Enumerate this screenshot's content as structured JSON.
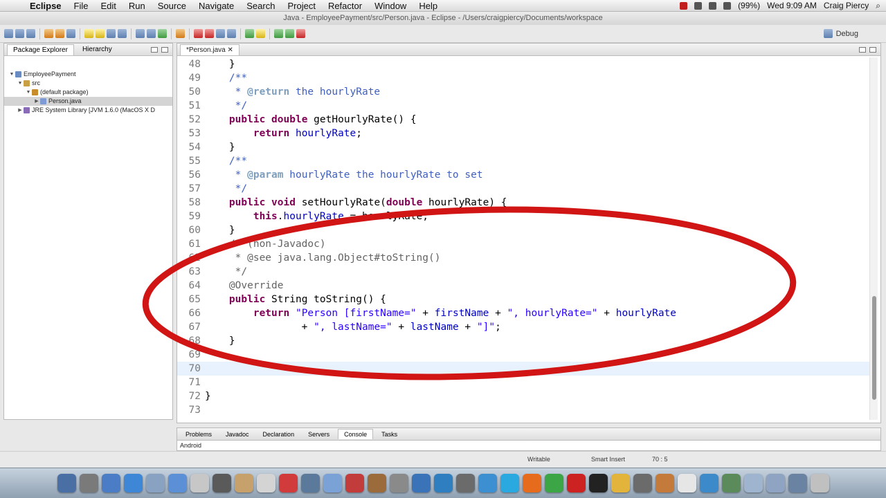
{
  "menubar": {
    "app": "Eclipse",
    "items": [
      "File",
      "Edit",
      "Run",
      "Source",
      "Navigate",
      "Search",
      "Project",
      "Refactor",
      "Window",
      "Help"
    ],
    "battery": "(99%)",
    "clock": "Wed 9:09 AM",
    "user": "Craig Piercy"
  },
  "window": {
    "title": "Java - EmployeePayment/src/Person.java - Eclipse - /Users/craigpiercy/Documents/workspace",
    "perspective": "Debug"
  },
  "package_explorer": {
    "tab_label": "Package Explorer",
    "tab2_label": "Hierarchy",
    "tree": [
      {
        "label": "EmployeePayment",
        "depth": 0,
        "arrow": "▼",
        "icon": "project-icon"
      },
      {
        "label": "src",
        "depth": 1,
        "arrow": "▼",
        "icon": "folder-icon"
      },
      {
        "label": "(default package)",
        "depth": 2,
        "arrow": "▼",
        "icon": "package-icon"
      },
      {
        "label": "Person.java",
        "depth": 3,
        "arrow": "▶",
        "icon": "java-file-icon",
        "selected": true
      },
      {
        "label": "JRE System Library [JVM 1.6.0 (MacOS X D",
        "depth": 1,
        "arrow": "▶",
        "icon": "library-icon"
      }
    ]
  },
  "editor": {
    "tab_label": "*Person.java",
    "current_line": 70,
    "lines": [
      {
        "n": "48",
        "html": "    }"
      },
      {
        "n": "49",
        "html": "    <span class='cm'>/**</span>"
      },
      {
        "n": "50",
        "html": "<span class='cm'>     * <span class='tag'>@return</span> the hourlyRate</span>"
      },
      {
        "n": "51",
        "html": "<span class='cm'>     */</span>"
      },
      {
        "n": "52",
        "html": "    <span class='kw'>public</span> <span class='kw'>double</span> getHourlyRate() {"
      },
      {
        "n": "53",
        "html": "        <span class='kw'>return</span> <span class='fld'>hourlyRate</span>;"
      },
      {
        "n": "54",
        "html": "    }"
      },
      {
        "n": "55",
        "html": "    <span class='cm'>/**</span>"
      },
      {
        "n": "56",
        "html": "<span class='cm'>     * <span class='tag'>@param</span> hourlyRate the hourlyRate to set</span>"
      },
      {
        "n": "57",
        "html": "<span class='cm'>     */</span>"
      },
      {
        "n": "58",
        "html": "    <span class='kw'>public</span> <span class='kw'>void</span> setHourlyRate(<span class='kw'>double</span> hourlyRate) {"
      },
      {
        "n": "59",
        "html": "        <span class='kw'>this</span>.<span class='fld'>hourlyRate</span> = hourlyRate;"
      },
      {
        "n": "60",
        "html": "    }"
      },
      {
        "n": "61",
        "html": "    <span class='ann'>/* (non-Javadoc)</span>"
      },
      {
        "n": "62",
        "html": "<span class='ann'>     * @see java.lang.Object#toString()</span>"
      },
      {
        "n": "63",
        "html": "<span class='ann'>     */</span>"
      },
      {
        "n": "64",
        "html": "    <span class='ann'>@Override</span>"
      },
      {
        "n": "65",
        "html": "    <span class='kw'>public</span> String toString() {"
      },
      {
        "n": "66",
        "html": "        <span class='kw'>return</span> <span class='str'>\"Person [firstName=\"</span> + <span class='fld'>firstName</span> + <span class='str'>\", hourlyRate=\"</span> + <span class='fld'>hourlyRate</span>"
      },
      {
        "n": "67",
        "html": "                + <span class='str'>\", lastName=\"</span> + <span class='fld'>lastName</span> + <span class='str'>\"]\"</span>;"
      },
      {
        "n": "68",
        "html": "    }"
      },
      {
        "n": "69",
        "html": ""
      },
      {
        "n": "70",
        "html": ""
      },
      {
        "n": "71",
        "html": ""
      },
      {
        "n": "72",
        "html": "}"
      },
      {
        "n": "73",
        "html": ""
      }
    ]
  },
  "bottom_panel": {
    "tabs": [
      "Problems",
      "Javadoc",
      "Declaration",
      "Servers",
      "Console",
      "Tasks"
    ],
    "active_tab": "Console",
    "content": "Android"
  },
  "status": {
    "mode": "Writable",
    "insert": "Smart Insert",
    "position": "70 : 5"
  },
  "colors": {
    "annotation": "#d11414",
    "keyword": "#7f0055",
    "string": "#2a00ff",
    "comment": "#3f5fbf"
  }
}
